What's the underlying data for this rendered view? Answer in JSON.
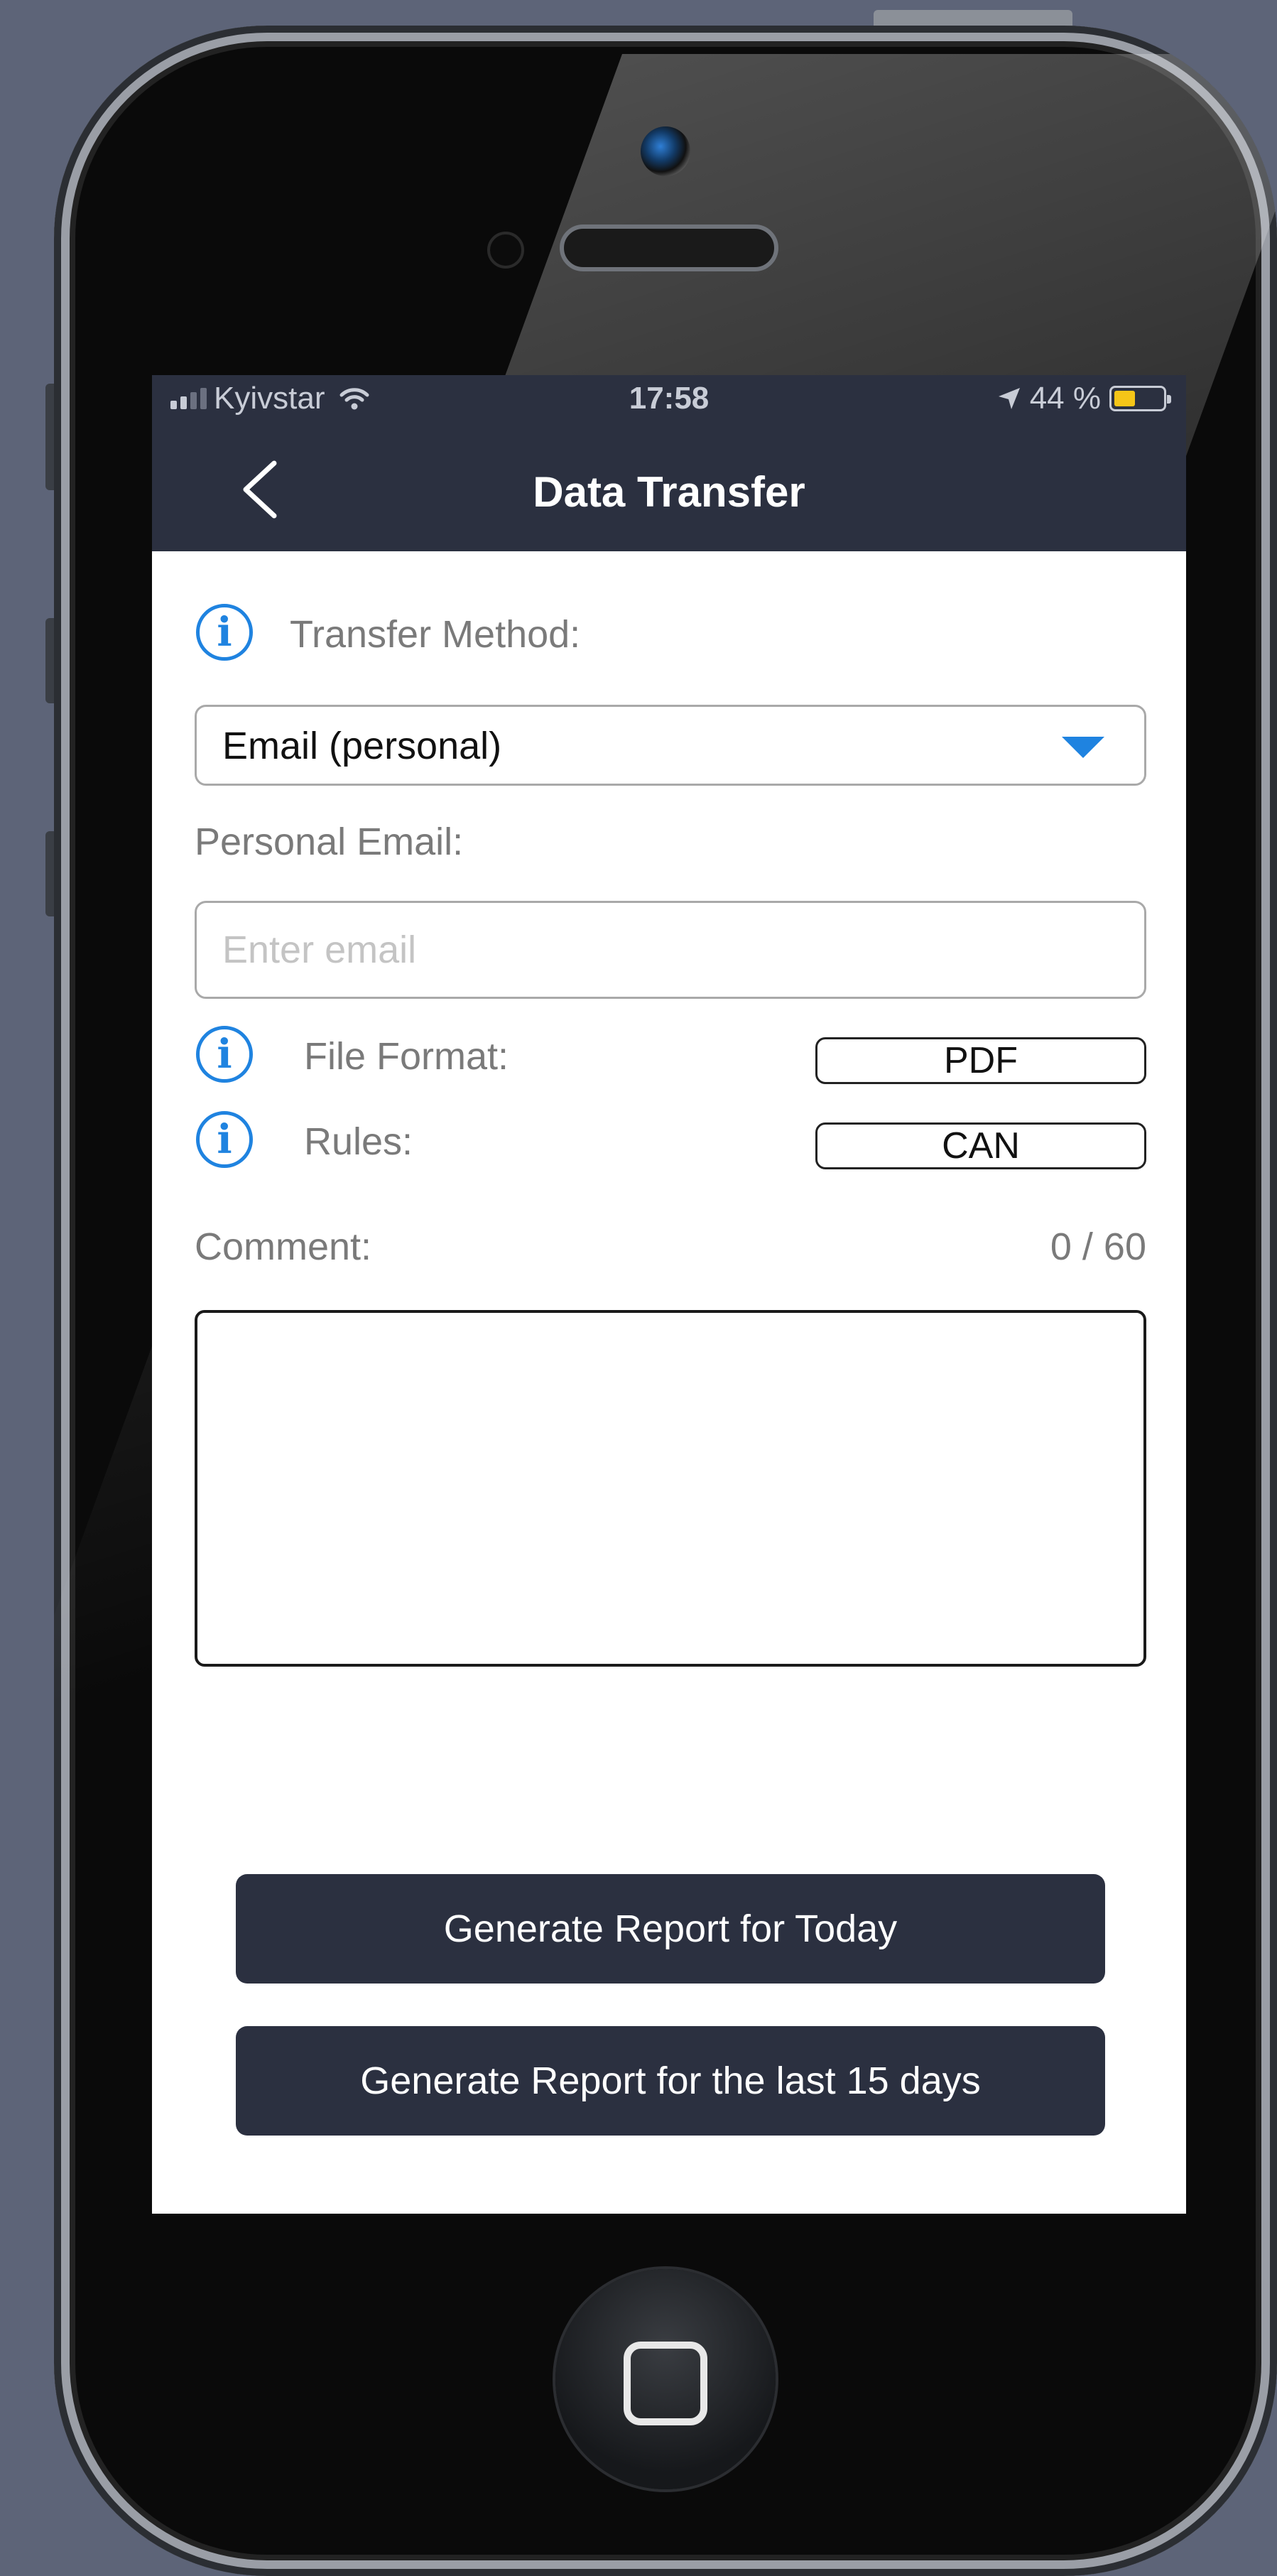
{
  "status_bar": {
    "carrier": "Kyivstar",
    "time": "17:58",
    "battery": "44 %",
    "battery_level": 0.44
  },
  "nav": {
    "title": "Data Transfer",
    "back_icon": "chevron-left-icon"
  },
  "form": {
    "transfer_method_label": "Transfer Method:",
    "transfer_method_value": "Email (personal)",
    "personal_email_label": "Personal Email:",
    "email_value": "",
    "email_placeholder": "Enter email",
    "file_format_label": "File Format:",
    "file_format_value": "PDF",
    "rules_label": "Rules:",
    "rules_value": "CAN",
    "comment_label": "Comment:",
    "comment_counter": "0 / 60",
    "comment_value": ""
  },
  "actions": {
    "today_label": "Generate Report for Today",
    "last15_label": "Generate Report for the last 15 days"
  },
  "colors": {
    "header_bg": "#2b3040",
    "accent": "#1f83e0",
    "battery": "#f5c518"
  }
}
